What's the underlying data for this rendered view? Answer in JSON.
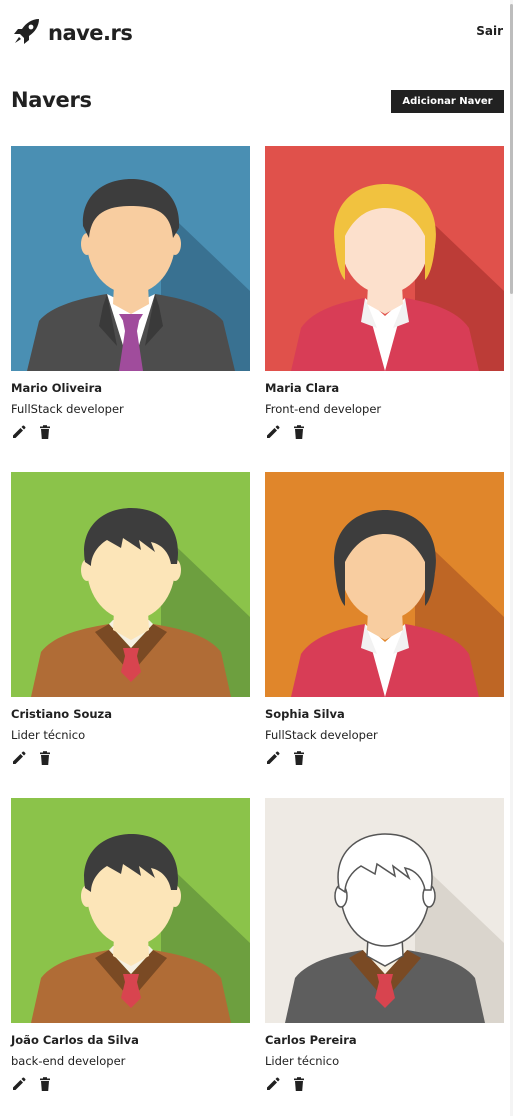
{
  "header": {
    "logo_text": "nave.rs",
    "logout_label": "Sair"
  },
  "main": {
    "title": "Navers",
    "add_button_label": "Adicionar Naver"
  },
  "navers": [
    {
      "name": "Mario Oliveira",
      "job": "FullStack developer",
      "bg": "#4a8fb3",
      "shadow": "#2b5a75",
      "hair": "#3d3d3d",
      "hair_style": "short",
      "skin": "#f8cda0",
      "outfit": "suit",
      "tie": "#a04c9c",
      "jacket": "#4d4d4d"
    },
    {
      "name": "Maria Clara",
      "job": "Front-end developer",
      "bg": "#e0514b",
      "shadow": "#9e2b28",
      "hair": "#f1c23f",
      "hair_style": "bob",
      "skin": "#fce0cc",
      "outfit": "blazer",
      "tie": "#fff",
      "jacket": "#d83d56"
    },
    {
      "name": "Cristiano Souza",
      "job": "Lider técnico",
      "bg": "#8bc34a",
      "shadow": "#568137",
      "hair": "#3d3d3d",
      "hair_style": "spiky",
      "skin": "#fce5b8",
      "outfit": "sweater",
      "tie": "#d8444f",
      "jacket": "#b06c36"
    },
    {
      "name": "Sophia Silva",
      "job": "FullStack developer",
      "bg": "#e0862b",
      "shadow": "#a24d21",
      "hair": "#3d3d3d",
      "hair_style": "bob",
      "skin": "#f8cda0",
      "outfit": "blazer",
      "tie": "#fff",
      "jacket": "#d83d56"
    },
    {
      "name": "João Carlos da Silva",
      "job": "back-end developer",
      "bg": "#8bc34a",
      "shadow": "#568137",
      "hair": "#3d3d3d",
      "hair_style": "spiky",
      "skin": "#fce5b8",
      "outfit": "sweater",
      "tie": "#d8444f",
      "jacket": "#b06c36"
    },
    {
      "name": "Carlos Pereira",
      "job": "Lider técnico",
      "bg": "#eeeae4",
      "shadow": "#cbc3b9",
      "hair": "#ffffff",
      "hair_style": "outline",
      "skin": "#ffffff",
      "outfit": "sweater",
      "tie": "#d8444f",
      "jacket": "#5e5e5e"
    }
  ],
  "icons": {
    "logo": "rocket-icon",
    "edit": "pencil-icon",
    "delete": "trash-icon"
  }
}
